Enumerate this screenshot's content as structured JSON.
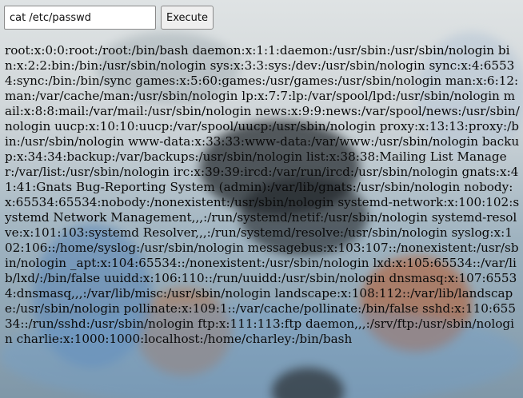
{
  "toolbar": {
    "command_value": "cat /etc/passwd",
    "execute_label": "Execute"
  },
  "output": {
    "text": "root:x:0:0:root:/root:/bin/bash daemon:x:1:1:daemon:/usr/sbin:/usr/sbin/nologin bin:x:2:2:bin:/bin:/usr/sbin/nologin sys:x:3:3:sys:/dev:/usr/sbin/nologin sync:x:4:65534:sync:/bin:/bin/sync games:x:5:60:games:/usr/games:/usr/sbin/nologin man:x:6:12:man:/var/cache/man:/usr/sbin/nologin lp:x:7:7:lp:/var/spool/lpd:/usr/sbin/nologin mail:x:8:8:mail:/var/mail:/usr/sbin/nologin news:x:9:9:news:/var/spool/news:/usr/sbin/nologin uucp:x:10:10:uucp:/var/spool/uucp:/usr/sbin/nologin proxy:x:13:13:proxy:/bin:/usr/sbin/nologin www-data:x:33:33:www-data:/var/www:/usr/sbin/nologin backup:x:34:34:backup:/var/backups:/usr/sbin/nologin list:x:38:38:Mailing List Manager:/var/list:/usr/sbin/nologin irc:x:39:39:ircd:/var/run/ircd:/usr/sbin/nologin gnats:x:41:41:Gnats Bug-Reporting System (admin):/var/lib/gnats:/usr/sbin/nologin nobody:x:65534:65534:nobody:/nonexistent:/usr/sbin/nologin systemd-network:x:100:102:systemd Network Management,,,:/run/systemd/netif:/usr/sbin/nologin systemd-resolve:x:101:103:systemd Resolver,,,:/run/systemd/resolve:/usr/sbin/nologin syslog:x:102:106::/home/syslog:/usr/sbin/nologin messagebus:x:103:107::/nonexistent:/usr/sbin/nologin _apt:x:104:65534::/nonexistent:/usr/sbin/nologin lxd:x:105:65534::/var/lib/lxd/:/bin/false uuidd:x:106:110::/run/uuidd:/usr/sbin/nologin dnsmasq:x:107:65534:dnsmasq,,,:/var/lib/misc:/usr/sbin/nologin landscape:x:108:112::/var/lib/landscape:/usr/sbin/nologin pollinate:x:109:1::/var/cache/pollinate:/bin/false sshd:x:110:65534::/run/sshd:/usr/sbin/nologin ftp:x:111:113:ftp daemon,,,:/srv/ftp:/usr/sbin/nologin charlie:x:1000:1000:localhost:/home/charley:/bin/bash"
  }
}
